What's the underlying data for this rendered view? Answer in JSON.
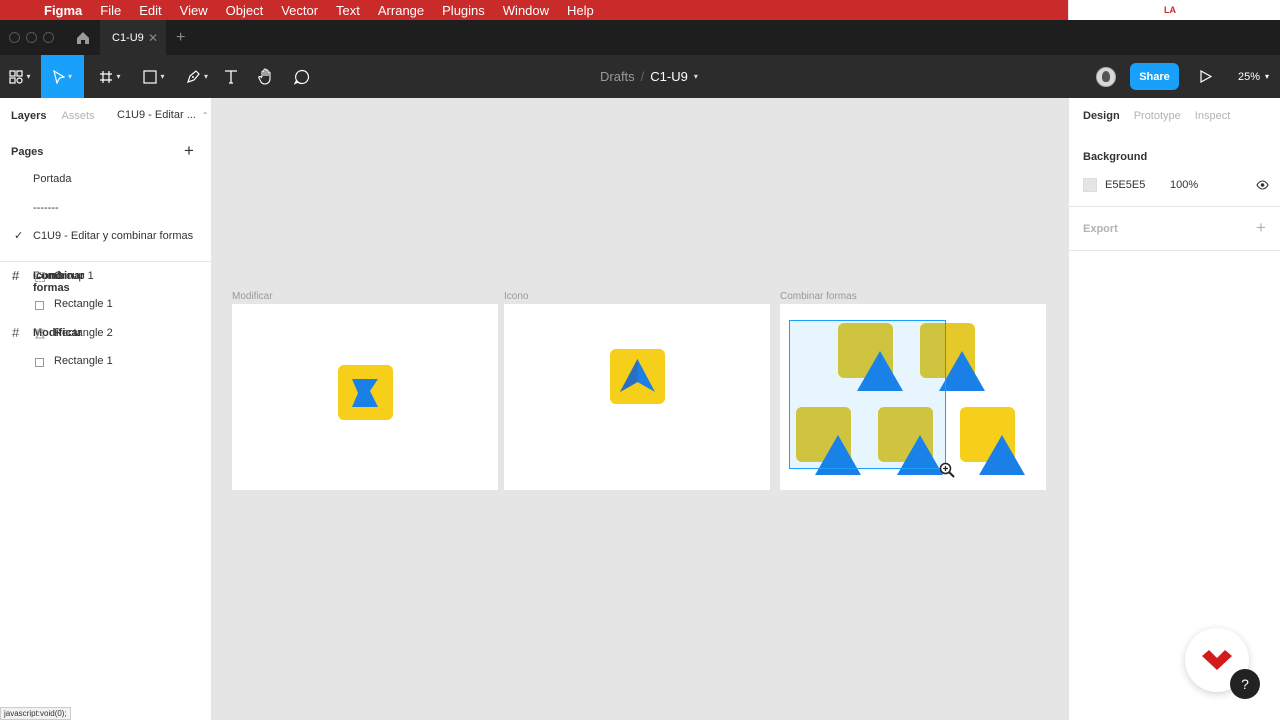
{
  "menubar": {
    "app": "Figma",
    "items": [
      "File",
      "Edit",
      "View",
      "Object",
      "Vector",
      "Text",
      "Arrange",
      "Plugins",
      "Window",
      "Help"
    ],
    "status_badge": "LA"
  },
  "tabs": {
    "file_tab": "C1-U9",
    "close": "✕",
    "new_tab": "+"
  },
  "toolbar": {
    "breadcrumb_parent": "Drafts",
    "breadcrumb_sep": "/",
    "breadcrumb_file": "C1-U9",
    "share_label": "Share",
    "zoom": "25%",
    "accent": "#18a0fb"
  },
  "left_panel": {
    "tab_layers": "Layers",
    "tab_assets": "Assets",
    "page_selector": "C1U9 - Editar ...",
    "pages_header": "Pages",
    "pages": [
      "Portada",
      "-------",
      "C1U9 - Editar y combinar formas"
    ],
    "current_page_check": "✓",
    "layers": [
      {
        "label": "Combinar formas",
        "kind": "frame"
      },
      {
        "label": "Icono",
        "kind": "frame"
      },
      {
        "label": "Group 1",
        "kind": "group"
      },
      {
        "label": "Rectangle 1",
        "kind": "rect"
      },
      {
        "label": "Modificar",
        "kind": "frame"
      },
      {
        "label": "Rectangle 2",
        "kind": "vector"
      },
      {
        "label": "Rectangle 1",
        "kind": "rect"
      }
    ]
  },
  "right_panel": {
    "tab_design": "Design",
    "tab_prototype": "Prototype",
    "tab_inspect": "Inspect",
    "background_header": "Background",
    "background_hex": "E5E5E5",
    "background_opacity": "100%",
    "export_header": "Export",
    "export_plus": "+"
  },
  "canvas": {
    "frames": [
      "Modificar",
      "Icono",
      "Combinar formas"
    ],
    "colors": {
      "yellow": "#f5cf1a",
      "blue": "#1a7fe6",
      "bg": "#e5e5e5"
    }
  },
  "status_url": "javascript:void(0);",
  "help": "?"
}
